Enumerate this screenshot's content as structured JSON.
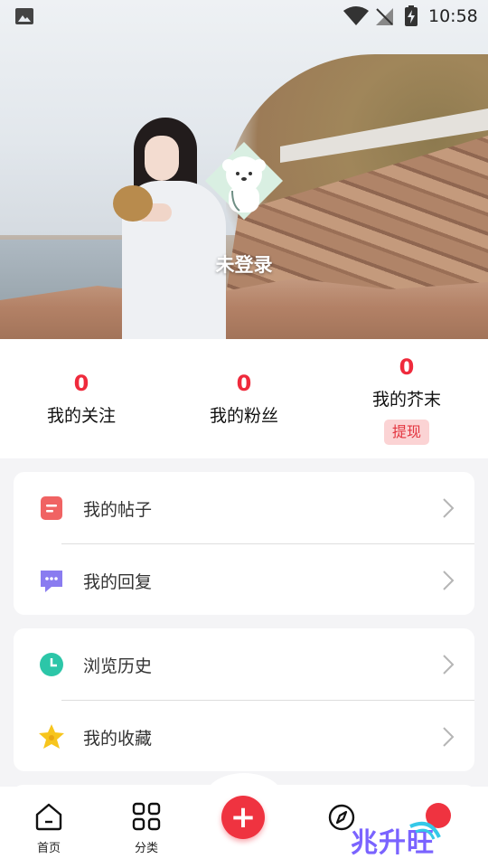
{
  "status_bar": {
    "time": "10:58"
  },
  "profile": {
    "login_label": "未登录"
  },
  "stats": [
    {
      "value": "0",
      "label": "我的关注"
    },
    {
      "value": "0",
      "label": "我的粉丝"
    },
    {
      "value": "0",
      "label": "我的芥末",
      "action": "提现"
    }
  ],
  "menu_groups": [
    {
      "items": [
        {
          "label": "我的帖子",
          "icon": "post-icon"
        },
        {
          "label": "我的回复",
          "icon": "reply-icon"
        }
      ]
    },
    {
      "items": [
        {
          "label": "浏览历史",
          "icon": "history-clock-icon"
        },
        {
          "label": "我的收藏",
          "icon": "favorite-star-icon"
        }
      ]
    }
  ],
  "bottom_nav": {
    "home": "首页",
    "category": "分类",
    "add": "+"
  },
  "watermark": "兆升旺",
  "colors": {
    "accent": "#ef2a3c",
    "withdraw_bg": "#fbd3d4",
    "post_icon": "#f06363",
    "reply_icon": "#8a7cf0",
    "history_icon": "#2cc6a8",
    "favorite_icon": "#f7c51d"
  }
}
